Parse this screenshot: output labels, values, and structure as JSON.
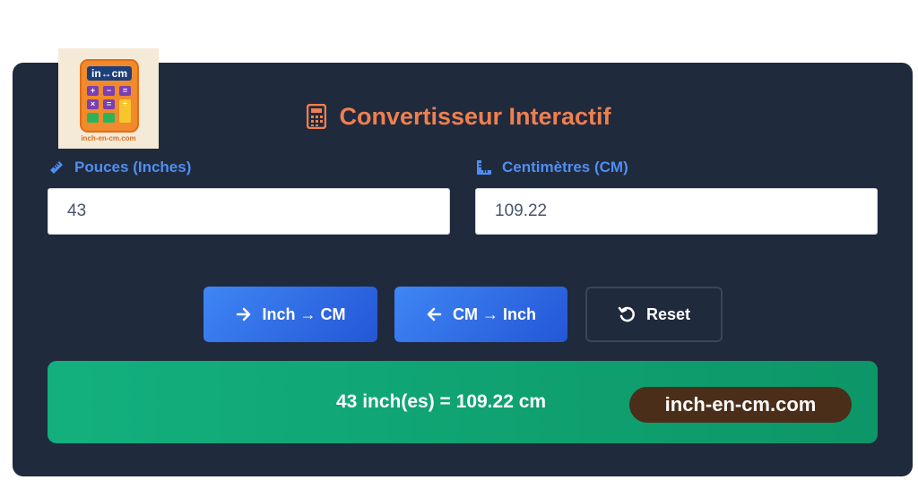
{
  "logo": {
    "screen_text": "in↔cm",
    "keys": [
      "+",
      "−",
      "=",
      "×",
      "=",
      "÷",
      "",
      "",
      "↻"
    ],
    "site_text": "inch-en-cm.com"
  },
  "converter": {
    "title": "Convertisseur Interactif",
    "title_icon": "calculator-icon",
    "inches": {
      "label": "Pouces (Inches)",
      "icon": "ruler-icon",
      "value": "43"
    },
    "centimeters": {
      "label": "Centimètres (CM)",
      "icon": "ruler-combined-icon",
      "value": "109.22"
    },
    "buttons": {
      "inch_to_cm": "Inch → CM",
      "cm_to_inch": "CM → Inch",
      "reset": "Reset"
    },
    "result": "43 inch(es) = 109.22 cm"
  },
  "watermark": "inch-en-cm.com",
  "colors": {
    "card_bg": "#1f2a3d",
    "title": "#f07f50",
    "label": "#4f8ef0",
    "button_blue": "#2f6fe8",
    "result_green": "#10a673",
    "watermark_bg": "#4a2e1a"
  }
}
